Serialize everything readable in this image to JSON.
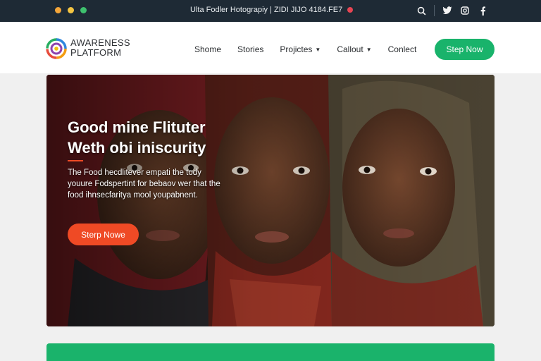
{
  "topbar": {
    "text": "Ulta Fodler Hotograpiy | ZIDI JIJO 4184.FE7",
    "dot_colors": [
      "#f4a63a",
      "#f4c542",
      "#3ec16e"
    ],
    "rec_color": "#e64553",
    "icons": [
      "search-icon",
      "twitter-icon",
      "instagram-icon",
      "facebook-icon"
    ]
  },
  "brand": {
    "line1": "AWARENESS",
    "line2": "PLATFORM"
  },
  "nav": {
    "items": [
      {
        "label": "Shome",
        "dropdown": false
      },
      {
        "label": "Stories",
        "dropdown": false
      },
      {
        "label": "Projictes",
        "dropdown": true
      },
      {
        "label": "Callout",
        "dropdown": true
      },
      {
        "label": "Conlect",
        "dropdown": false
      }
    ],
    "cta_label": "Step Now"
  },
  "hero": {
    "title_line1": "Good mine Flituter",
    "title_line2": "Weth obi iniscurity",
    "body": "The Food hecdlitever empati the tody youure Fodspertint for bebaov wer that the food ihnsecfaritya mool youpabnent.",
    "cta_label": "Sterp Nowe"
  },
  "colors": {
    "topbar_bg": "#1e2a35",
    "primary_green": "#19b36b",
    "accent_orange": "#ef4a25"
  }
}
